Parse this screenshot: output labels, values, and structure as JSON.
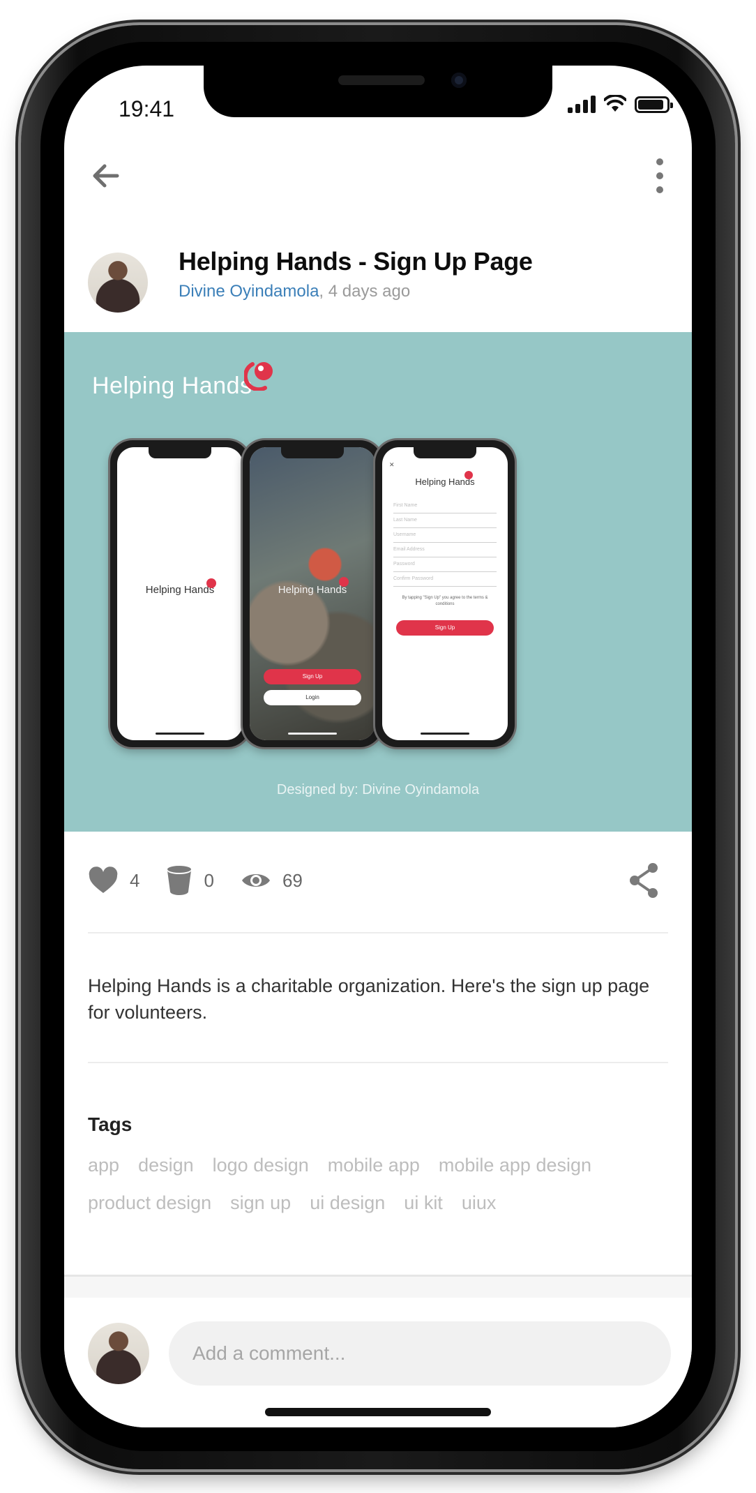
{
  "status_bar": {
    "time": "19:41",
    "battery_level": 0.9,
    "signal_bars": 4
  },
  "nav": {
    "back_icon": "arrow-left-icon",
    "more_icon": "more-vertical-icon"
  },
  "shot": {
    "title": "Helping Hands - Sign Up Page",
    "author": "Divine Oyindamola",
    "separator": ",",
    "time_ago": " 4 days ago"
  },
  "preview": {
    "logo_text": "Helping Hands",
    "phone1_logo": "Helping Hands",
    "phone2_logo": "Helping Hands",
    "phone2_signup": "Sign Up",
    "phone2_login": "Login",
    "phone3_logo": "Helping Hands",
    "phone3_fields": [
      "First Name",
      "Last Name",
      "Username",
      "Email Address",
      "Password",
      "Confirm Password"
    ],
    "phone3_terms": "By tapping \"Sign Up\" you agree to the terms & conditions",
    "phone3_signup": "Sign Up",
    "designed_by": "Designed by: Divine Oyindamola",
    "brand_color": "#e0344a",
    "background_color": "#96c7c6"
  },
  "stats": {
    "likes": "4",
    "buckets": "0",
    "views": "69",
    "like_icon": "heart-icon",
    "bucket_icon": "bucket-icon",
    "view_icon": "eye-icon",
    "share_icon": "share-icon"
  },
  "description": "Helping Hands is a charitable organization. Here's the sign up page for volunteers.",
  "tags": {
    "heading": "Tags",
    "items": [
      "app",
      "design",
      "logo design",
      "mobile app",
      "mobile app design",
      "product design",
      "sign up",
      "ui design",
      "ui kit",
      "uiux"
    ]
  },
  "comment": {
    "placeholder": "Add a comment..."
  }
}
